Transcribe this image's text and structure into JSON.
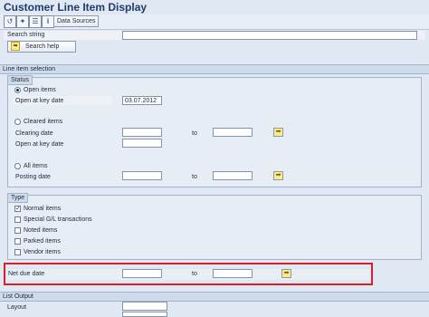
{
  "app": {
    "title": "Customer Line Item Display"
  },
  "toolbar": {
    "data_sources_label": "Data Sources"
  },
  "search": {
    "label": "Search string",
    "value": "",
    "help_button": "Search help"
  },
  "line_item_selection": {
    "header": "Line item selection",
    "status": {
      "title": "Status",
      "open_items": {
        "label": "Open items",
        "selected": true,
        "key_date_label": "Open at key date",
        "key_date_value": "03.07.2012"
      },
      "cleared_items": {
        "label": "Cleared items",
        "selected": false,
        "clearing_date_label": "Clearing date",
        "to_label": "to",
        "key_date_label": "Open at key date"
      },
      "all_items": {
        "label": "All items",
        "selected": false,
        "posting_date_label": "Posting date",
        "to_label": "to"
      }
    },
    "type": {
      "title": "Type",
      "options": [
        {
          "label": "Normal items",
          "checked": true
        },
        {
          "label": "Special G/L transactions",
          "checked": false
        },
        {
          "label": "Noted items",
          "checked": false
        },
        {
          "label": "Parked items",
          "checked": false
        },
        {
          "label": "Vendor items",
          "checked": false
        }
      ]
    },
    "net_due": {
      "label": "Net due date",
      "to_label": "to"
    }
  },
  "list_output": {
    "header": "List Output",
    "layout_label": "Layout"
  },
  "icons": {
    "execute": "execute-icon",
    "save": "save-variant-icon",
    "variant": "get-variant-icon",
    "info": "info-icon",
    "multiple_selection": "multiple-selection-arrow-icon"
  }
}
